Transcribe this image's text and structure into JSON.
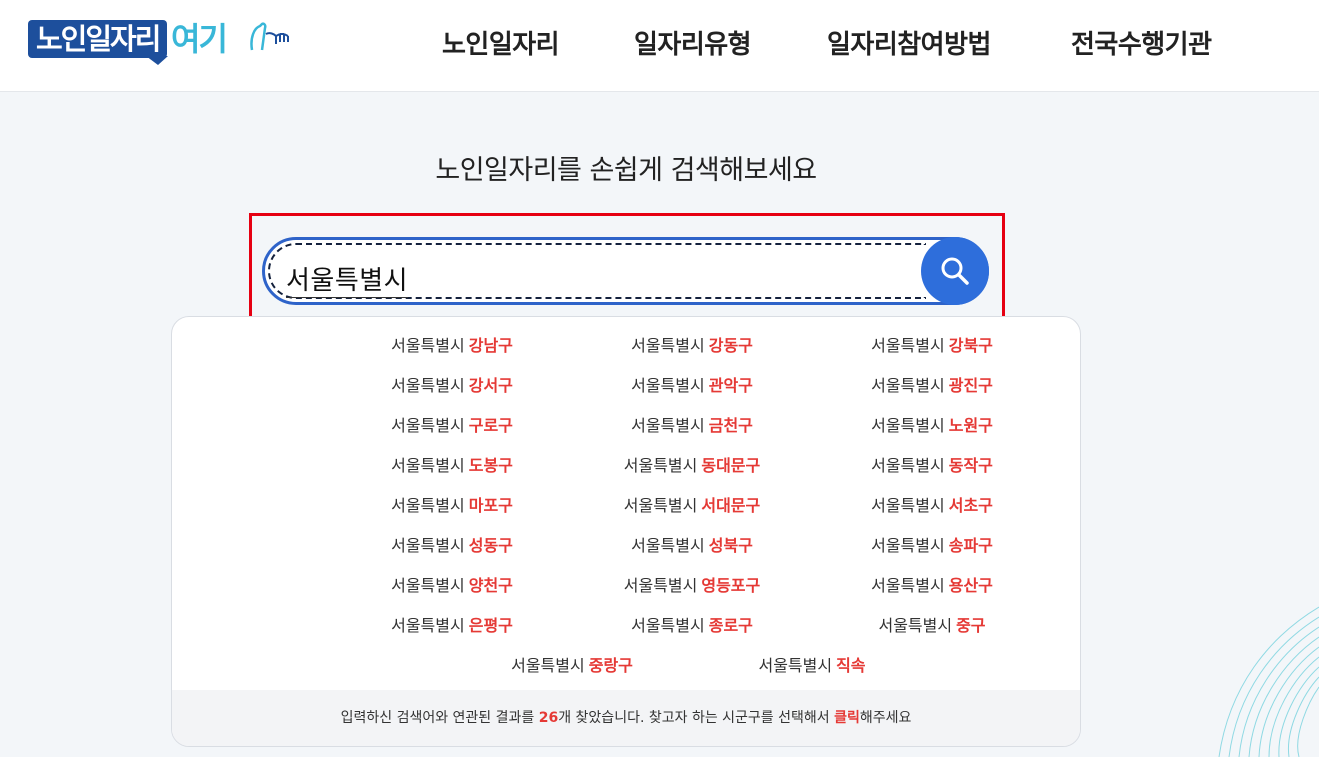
{
  "logo": {
    "main": "노인일자리",
    "accent": "여기"
  },
  "nav": [
    {
      "label": "노인일자리"
    },
    {
      "label": "일자리유형"
    },
    {
      "label": "일자리참여방법"
    },
    {
      "label": "전국수행기관"
    }
  ],
  "hero": {
    "title": "노인일자리를 손쉽게 검색해보세요"
  },
  "search": {
    "value": "서울특별시",
    "button_icon": "search-icon"
  },
  "results": {
    "items": [
      {
        "city": "서울특별시",
        "district": "강남구"
      },
      {
        "city": "서울특별시",
        "district": "강동구"
      },
      {
        "city": "서울특별시",
        "district": "강북구"
      },
      {
        "city": "서울특별시",
        "district": "강서구"
      },
      {
        "city": "서울특별시",
        "district": "관악구"
      },
      {
        "city": "서울특별시",
        "district": "광진구"
      },
      {
        "city": "서울특별시",
        "district": "구로구"
      },
      {
        "city": "서울특별시",
        "district": "금천구"
      },
      {
        "city": "서울특별시",
        "district": "노원구"
      },
      {
        "city": "서울특별시",
        "district": "도봉구"
      },
      {
        "city": "서울특별시",
        "district": "동대문구"
      },
      {
        "city": "서울특별시",
        "district": "동작구"
      },
      {
        "city": "서울특별시",
        "district": "마포구"
      },
      {
        "city": "서울특별시",
        "district": "서대문구"
      },
      {
        "city": "서울특별시",
        "district": "서초구"
      },
      {
        "city": "서울특별시",
        "district": "성동구"
      },
      {
        "city": "서울특별시",
        "district": "성북구"
      },
      {
        "city": "서울특별시",
        "district": "송파구"
      },
      {
        "city": "서울특별시",
        "district": "양천구"
      },
      {
        "city": "서울특별시",
        "district": "영등포구"
      },
      {
        "city": "서울특별시",
        "district": "용산구"
      },
      {
        "city": "서울특별시",
        "district": "은평구"
      },
      {
        "city": "서울특별시",
        "district": "종로구"
      },
      {
        "city": "서울특별시",
        "district": "중구"
      },
      {
        "city": "서울특별시",
        "district": "중랑구"
      },
      {
        "city": "서울특별시",
        "district": "직속"
      }
    ],
    "footer": {
      "prefix": "입력하신 검색어와 연관된 결과를 ",
      "count": "26",
      "middle": "개 찾았습니다. 찾고자 하는 시군구를 선택해서 ",
      "click": "클릭",
      "suffix": "해주세요"
    }
  },
  "colors": {
    "brand": "#1d4f9c",
    "accent": "#39b7d8",
    "highlight": "#e53935",
    "search_button": "#2e6edb",
    "focus_frame": "#e60012"
  }
}
